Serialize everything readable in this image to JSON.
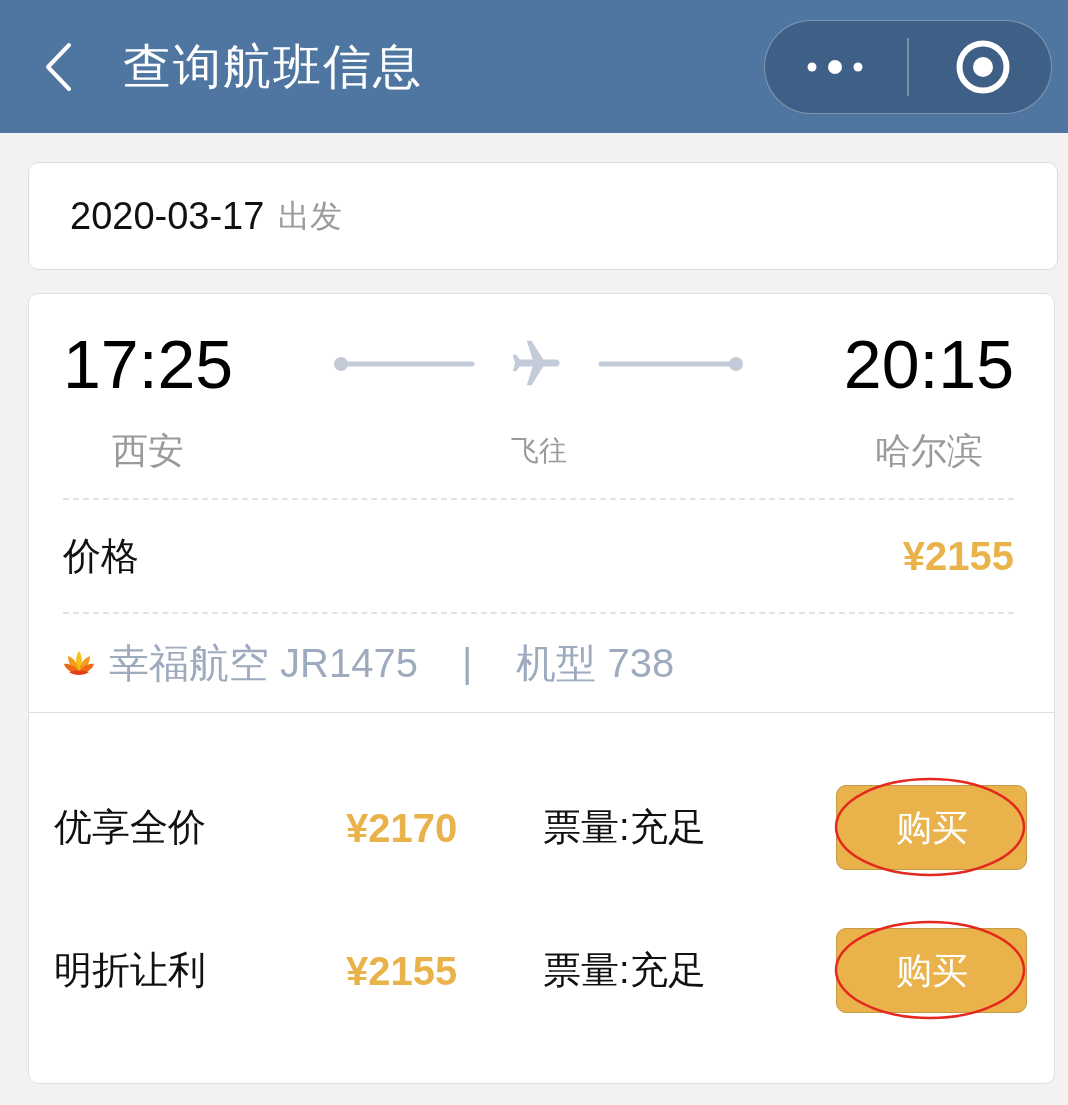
{
  "header": {
    "title": "查询航班信息"
  },
  "date": {
    "value": "2020-03-17",
    "label": "出发"
  },
  "flight": {
    "departure_time": "17:25",
    "arrival_time": "20:15",
    "departure_city": "西安",
    "route_label": "飞往",
    "arrival_city": "哈尔滨",
    "price_label": "价格",
    "price": "¥2155",
    "airline": "幸福航空 JR1475",
    "separator": "|",
    "aircraft": "机型 738"
  },
  "fares": [
    {
      "name": "优享全价",
      "price": "¥2170",
      "availability": "票量:充足",
      "button": "购买",
      "highlighted": true
    },
    {
      "name": "明折让利",
      "price": "¥2155",
      "availability": "票量:充足",
      "button": "购买",
      "highlighted": true
    }
  ]
}
